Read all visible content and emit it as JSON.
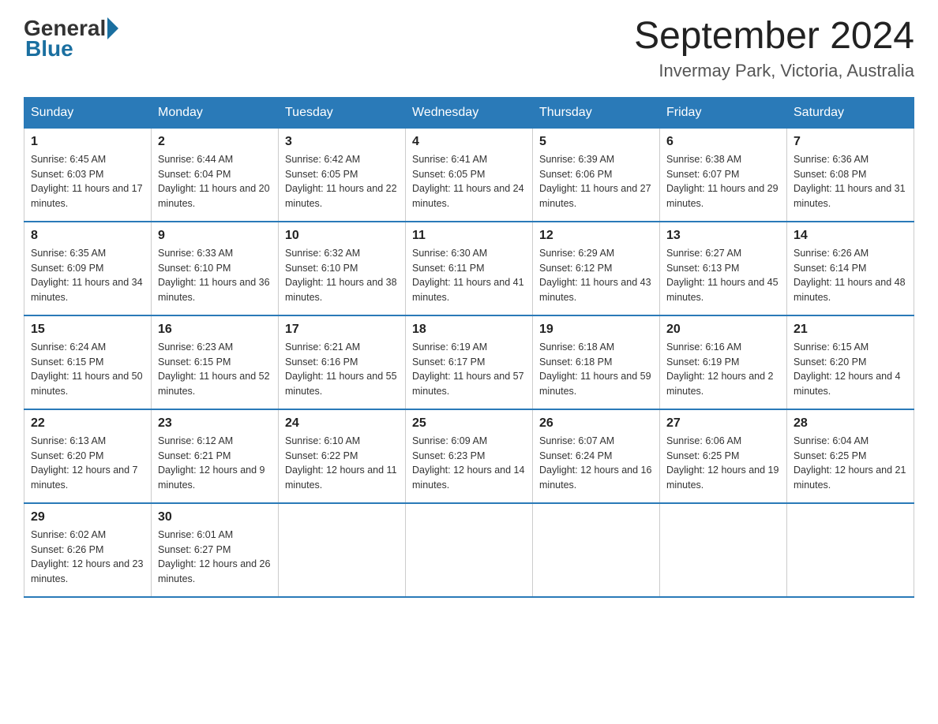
{
  "header": {
    "logo_general": "General",
    "logo_blue": "Blue",
    "month_title": "September 2024",
    "location": "Invermay Park, Victoria, Australia"
  },
  "days_of_week": [
    "Sunday",
    "Monday",
    "Tuesday",
    "Wednesday",
    "Thursday",
    "Friday",
    "Saturday"
  ],
  "weeks": [
    [
      {
        "day": "1",
        "sunrise": "6:45 AM",
        "sunset": "6:03 PM",
        "daylight": "11 hours and 17 minutes."
      },
      {
        "day": "2",
        "sunrise": "6:44 AM",
        "sunset": "6:04 PM",
        "daylight": "11 hours and 20 minutes."
      },
      {
        "day": "3",
        "sunrise": "6:42 AM",
        "sunset": "6:05 PM",
        "daylight": "11 hours and 22 minutes."
      },
      {
        "day": "4",
        "sunrise": "6:41 AM",
        "sunset": "6:05 PM",
        "daylight": "11 hours and 24 minutes."
      },
      {
        "day": "5",
        "sunrise": "6:39 AM",
        "sunset": "6:06 PM",
        "daylight": "11 hours and 27 minutes."
      },
      {
        "day": "6",
        "sunrise": "6:38 AM",
        "sunset": "6:07 PM",
        "daylight": "11 hours and 29 minutes."
      },
      {
        "day": "7",
        "sunrise": "6:36 AM",
        "sunset": "6:08 PM",
        "daylight": "11 hours and 31 minutes."
      }
    ],
    [
      {
        "day": "8",
        "sunrise": "6:35 AM",
        "sunset": "6:09 PM",
        "daylight": "11 hours and 34 minutes."
      },
      {
        "day": "9",
        "sunrise": "6:33 AM",
        "sunset": "6:10 PM",
        "daylight": "11 hours and 36 minutes."
      },
      {
        "day": "10",
        "sunrise": "6:32 AM",
        "sunset": "6:10 PM",
        "daylight": "11 hours and 38 minutes."
      },
      {
        "day": "11",
        "sunrise": "6:30 AM",
        "sunset": "6:11 PM",
        "daylight": "11 hours and 41 minutes."
      },
      {
        "day": "12",
        "sunrise": "6:29 AM",
        "sunset": "6:12 PM",
        "daylight": "11 hours and 43 minutes."
      },
      {
        "day": "13",
        "sunrise": "6:27 AM",
        "sunset": "6:13 PM",
        "daylight": "11 hours and 45 minutes."
      },
      {
        "day": "14",
        "sunrise": "6:26 AM",
        "sunset": "6:14 PM",
        "daylight": "11 hours and 48 minutes."
      }
    ],
    [
      {
        "day": "15",
        "sunrise": "6:24 AM",
        "sunset": "6:15 PM",
        "daylight": "11 hours and 50 minutes."
      },
      {
        "day": "16",
        "sunrise": "6:23 AM",
        "sunset": "6:15 PM",
        "daylight": "11 hours and 52 minutes."
      },
      {
        "day": "17",
        "sunrise": "6:21 AM",
        "sunset": "6:16 PM",
        "daylight": "11 hours and 55 minutes."
      },
      {
        "day": "18",
        "sunrise": "6:19 AM",
        "sunset": "6:17 PM",
        "daylight": "11 hours and 57 minutes."
      },
      {
        "day": "19",
        "sunrise": "6:18 AM",
        "sunset": "6:18 PM",
        "daylight": "11 hours and 59 minutes."
      },
      {
        "day": "20",
        "sunrise": "6:16 AM",
        "sunset": "6:19 PM",
        "daylight": "12 hours and 2 minutes."
      },
      {
        "day": "21",
        "sunrise": "6:15 AM",
        "sunset": "6:20 PM",
        "daylight": "12 hours and 4 minutes."
      }
    ],
    [
      {
        "day": "22",
        "sunrise": "6:13 AM",
        "sunset": "6:20 PM",
        "daylight": "12 hours and 7 minutes."
      },
      {
        "day": "23",
        "sunrise": "6:12 AM",
        "sunset": "6:21 PM",
        "daylight": "12 hours and 9 minutes."
      },
      {
        "day": "24",
        "sunrise": "6:10 AM",
        "sunset": "6:22 PM",
        "daylight": "12 hours and 11 minutes."
      },
      {
        "day": "25",
        "sunrise": "6:09 AM",
        "sunset": "6:23 PM",
        "daylight": "12 hours and 14 minutes."
      },
      {
        "day": "26",
        "sunrise": "6:07 AM",
        "sunset": "6:24 PM",
        "daylight": "12 hours and 16 minutes."
      },
      {
        "day": "27",
        "sunrise": "6:06 AM",
        "sunset": "6:25 PM",
        "daylight": "12 hours and 19 minutes."
      },
      {
        "day": "28",
        "sunrise": "6:04 AM",
        "sunset": "6:25 PM",
        "daylight": "12 hours and 21 minutes."
      }
    ],
    [
      {
        "day": "29",
        "sunrise": "6:02 AM",
        "sunset": "6:26 PM",
        "daylight": "12 hours and 23 minutes."
      },
      {
        "day": "30",
        "sunrise": "6:01 AM",
        "sunset": "6:27 PM",
        "daylight": "12 hours and 26 minutes."
      },
      {
        "day": "",
        "sunrise": "",
        "sunset": "",
        "daylight": ""
      },
      {
        "day": "",
        "sunrise": "",
        "sunset": "",
        "daylight": ""
      },
      {
        "day": "",
        "sunrise": "",
        "sunset": "",
        "daylight": ""
      },
      {
        "day": "",
        "sunrise": "",
        "sunset": "",
        "daylight": ""
      },
      {
        "day": "",
        "sunrise": "",
        "sunset": "",
        "daylight": ""
      }
    ]
  ]
}
